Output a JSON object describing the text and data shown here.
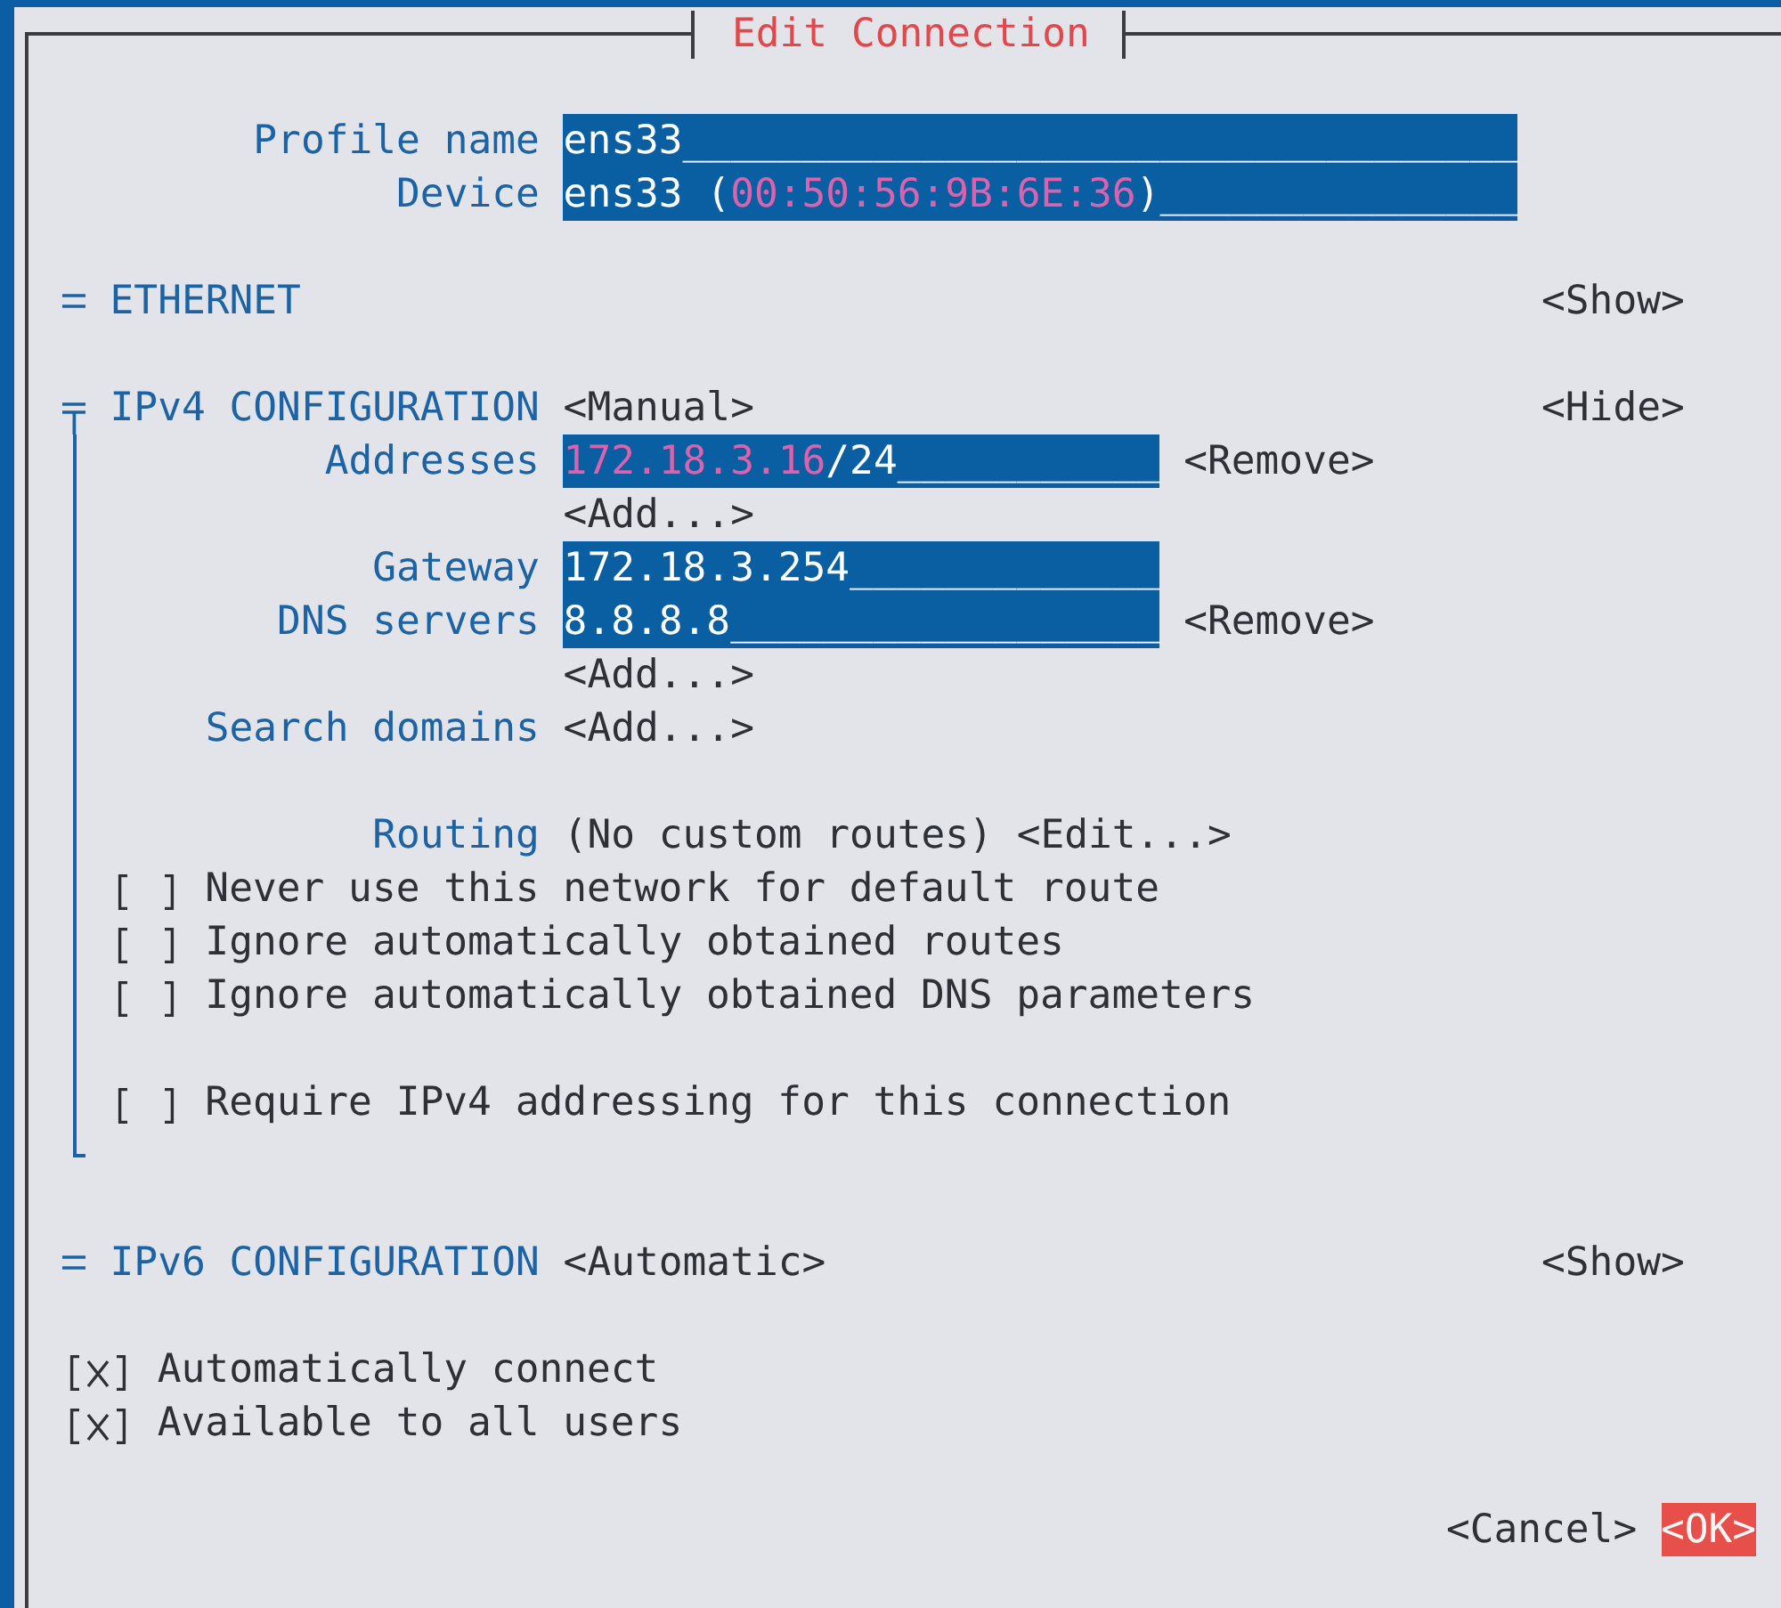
{
  "window": {
    "title": "Edit Connection"
  },
  "profile_fields": [
    {
      "label": "Profile name",
      "segments": [
        {
          "kind": "plain",
          "text": "ens33___________________________________"
        }
      ]
    },
    {
      "label": "Device",
      "segments": [
        {
          "kind": "plain",
          "text": "ens33 ("
        },
        {
          "kind": "accent",
          "text": "00:50:56:9B:6E:36"
        },
        {
          "kind": "plain",
          "text": ")_______________"
        }
      ]
    }
  ],
  "sections": [
    {
      "title": "ETHERNET",
      "expanded": false,
      "toggle": "<Show>"
    },
    {
      "title": "IPv4 CONFIGURATION",
      "mode": "<Manual>",
      "expanded": true,
      "toggle": "<Hide>",
      "rows": [
        {
          "kind": "field",
          "label": "Addresses",
          "segments": [
            {
              "kind": "accent",
              "text": "172.18.3.16"
            },
            {
              "kind": "plain",
              "text": "/24___________"
            }
          ],
          "action": "<Remove>"
        },
        {
          "kind": "button",
          "button": "<Add...>"
        },
        {
          "kind": "field",
          "label": "Gateway",
          "segments": [
            {
              "kind": "plain",
              "text": "172.18.3.254_____________"
            }
          ]
        },
        {
          "kind": "field",
          "label": "DNS servers",
          "segments": [
            {
              "kind": "plain",
              "text": "8.8.8.8__________________"
            }
          ],
          "action": "<Remove>"
        },
        {
          "kind": "button",
          "button": "<Add...>"
        },
        {
          "kind": "button",
          "label": "Search domains",
          "button": "<Add...>"
        }
      ],
      "routing": {
        "label": "Routing",
        "value": "(No custom routes)",
        "button": "<Edit...>"
      },
      "option_groups": [
        {
          "options": [
            {
              "label": "Never use this network for default route",
              "checked": false
            },
            {
              "label": "Ignore automatically obtained routes",
              "checked": false
            },
            {
              "label": "Ignore automatically obtained DNS parameters",
              "checked": false
            }
          ]
        },
        {
          "options": [
            {
              "label": "Require IPv4 addressing for this connection",
              "checked": false
            }
          ]
        }
      ]
    },
    {
      "title": "IPv6 CONFIGURATION",
      "mode": "<Automatic>",
      "expanded": false,
      "toggle": "<Show>"
    }
  ],
  "options": [
    {
      "label": "Automatically connect",
      "checked": true
    },
    {
      "label": "Available to all users",
      "checked": true
    }
  ],
  "buttons": [
    {
      "label": "<Cancel>",
      "focused": false
    },
    {
      "label": "<OK>",
      "focused": true
    }
  ]
}
